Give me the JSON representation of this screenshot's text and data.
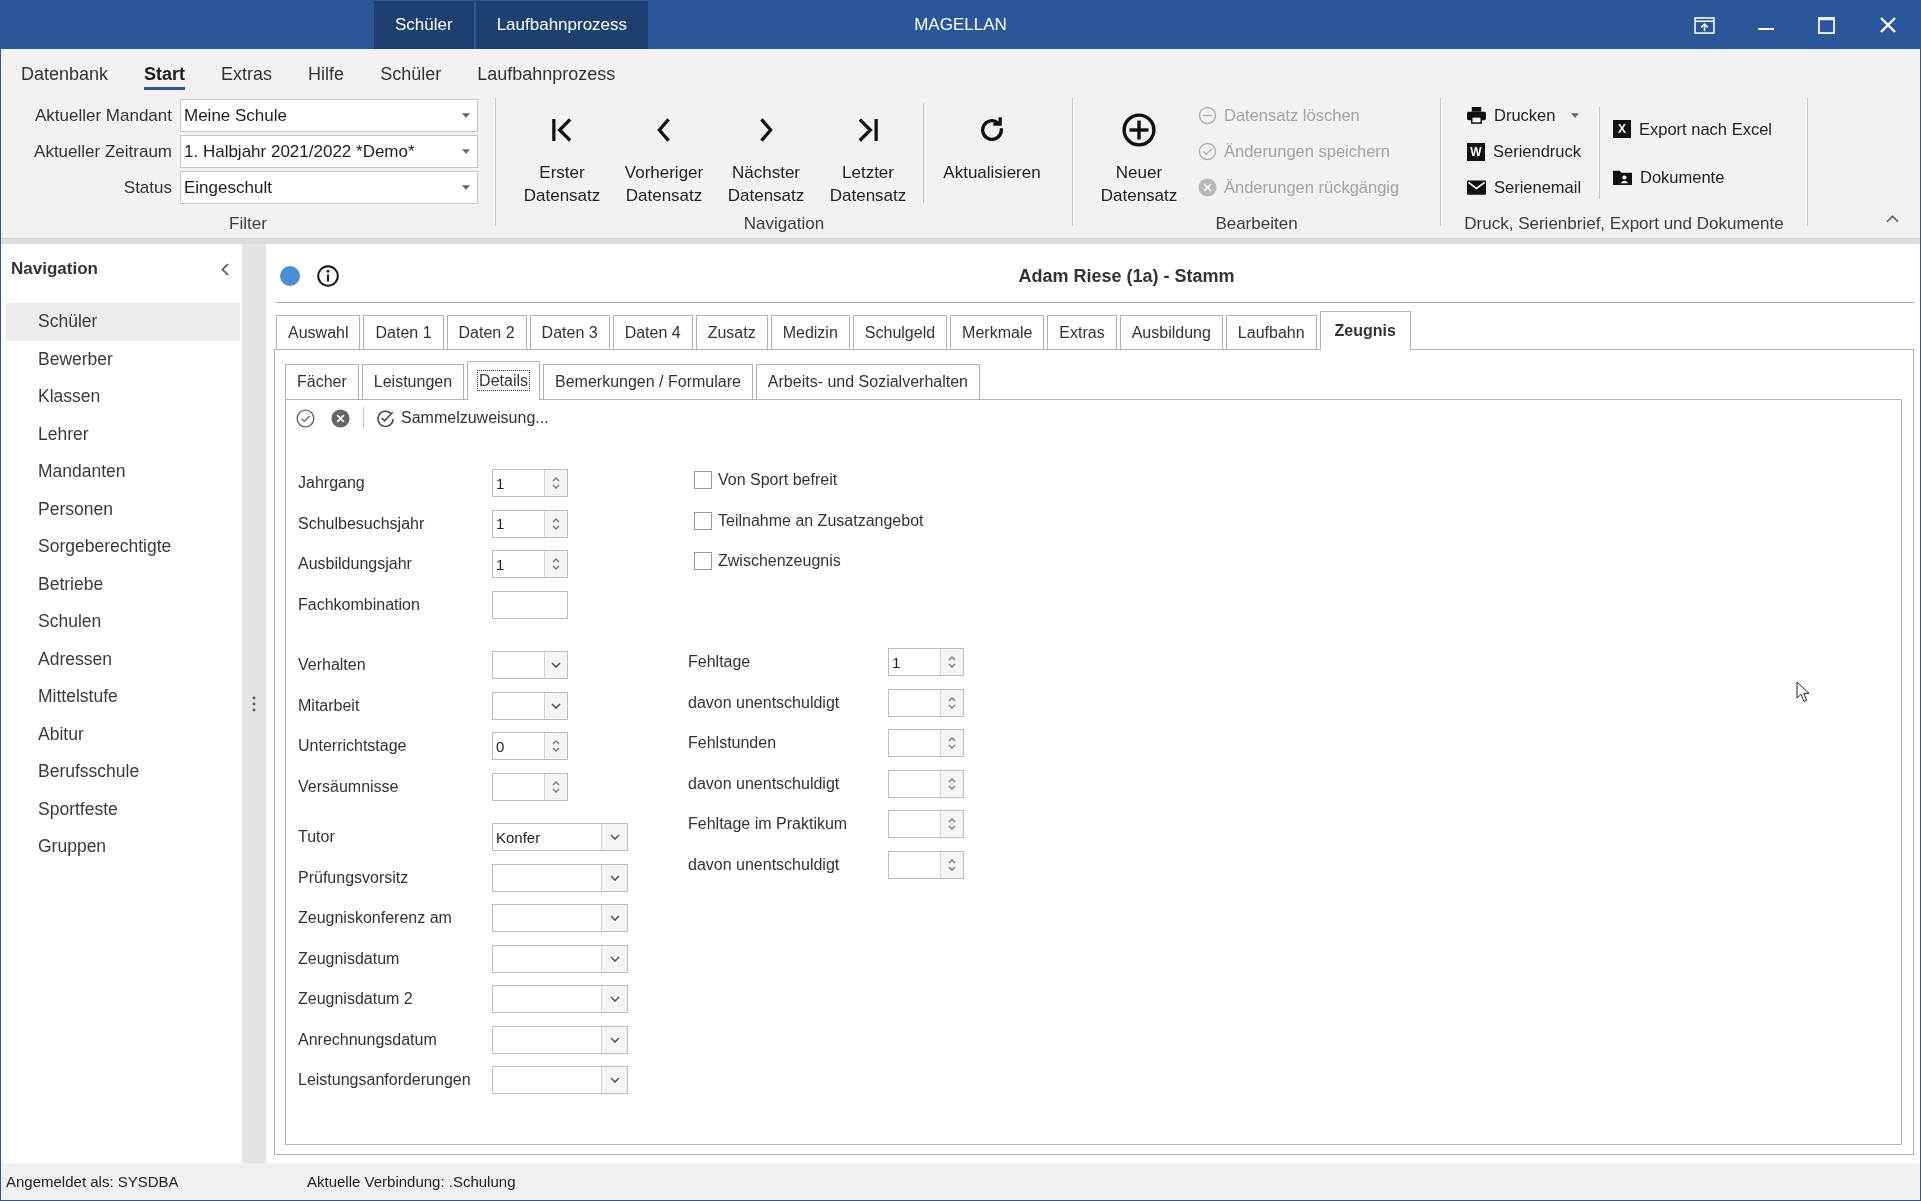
{
  "window": {
    "title": "MAGELLAN",
    "context_tabs": [
      "Schüler",
      "Laufbahnprozess"
    ]
  },
  "ribbon_tabs": [
    {
      "label": "Datenbank",
      "selected": false
    },
    {
      "label": "Start",
      "selected": true
    },
    {
      "label": "Extras",
      "selected": false
    },
    {
      "label": "Hilfe",
      "selected": false
    },
    {
      "label": "Schüler",
      "selected": false
    },
    {
      "label": "Laufbahnprozess",
      "selected": false
    }
  ],
  "ribbon": {
    "filter": {
      "label": "Filter",
      "fields": [
        {
          "label": "Aktueller Mandant",
          "value": "Meine Schule"
        },
        {
          "label": "Aktueller Zeitraum",
          "value": "1. Halbjahr 2021/2022 *Demo*"
        },
        {
          "label": "Status",
          "value": "Eingeschult"
        }
      ]
    },
    "navigation": {
      "label": "Navigation",
      "buttons": [
        {
          "label": "Erster Datensatz"
        },
        {
          "label": "Vorheriger Datensatz"
        },
        {
          "label": "Nächster Datensatz"
        },
        {
          "label": "Letzter Datensatz"
        }
      ],
      "refresh_button": {
        "label": "Aktualisieren"
      }
    },
    "edit": {
      "label": "Bearbeiten",
      "new_button": {
        "label": "Neuer Datensatz"
      },
      "actions": [
        {
          "label": "Datensatz löschen",
          "disabled": true
        },
        {
          "label": "Änderungen speichern",
          "disabled": true
        },
        {
          "label": "Änderungen rückgängig",
          "disabled": true
        }
      ]
    },
    "output": {
      "label": "Druck, Serienbrief, Export und Dokumente",
      "print_actions": [
        {
          "label": "Drucken",
          "dropdown": true
        },
        {
          "label": "Seriendruck",
          "badge": "W",
          "dropdown": false
        },
        {
          "label": "Serienemail",
          "dropdown": false
        }
      ],
      "export_actions": [
        {
          "label": "Export nach Excel",
          "badge": "X"
        },
        {
          "label": "Dokumente"
        }
      ]
    }
  },
  "sidebar": {
    "title": "Navigation",
    "items": [
      {
        "label": "Schüler",
        "selected": true
      },
      {
        "label": "Bewerber",
        "selected": false
      },
      {
        "label": "Klassen",
        "selected": false
      },
      {
        "label": "Lehrer",
        "selected": false
      },
      {
        "label": "Mandanten",
        "selected": false
      },
      {
        "label": "Personen",
        "selected": false
      },
      {
        "label": "Sorgeberechtigte",
        "selected": false
      },
      {
        "label": "Betriebe",
        "selected": false
      },
      {
        "label": "Schulen",
        "selected": false
      },
      {
        "label": "Adressen",
        "selected": false
      },
      {
        "label": "Mittelstufe",
        "selected": false
      },
      {
        "label": "Abitur",
        "selected": false
      },
      {
        "label": "Berufsschule",
        "selected": false
      },
      {
        "label": "Sportfeste",
        "selected": false
      },
      {
        "label": "Gruppen",
        "selected": false
      }
    ]
  },
  "record": {
    "title": "Adam Riese (1a) - Stamm"
  },
  "tabs": [
    {
      "label": "Auswahl",
      "selected": false
    },
    {
      "label": "Daten 1",
      "selected": false
    },
    {
      "label": "Daten 2",
      "selected": false
    },
    {
      "label": "Daten 3",
      "selected": false
    },
    {
      "label": "Daten 4",
      "selected": false
    },
    {
      "label": "Zusatz",
      "selected": false
    },
    {
      "label": "Medizin",
      "selected": false
    },
    {
      "label": "Schulgeld",
      "selected": false
    },
    {
      "label": "Merkmale",
      "selected": false
    },
    {
      "label": "Extras",
      "selected": false
    },
    {
      "label": "Ausbildung",
      "selected": false
    },
    {
      "label": "Laufbahn",
      "selected": false
    },
    {
      "label": "Zeugnis",
      "selected": true
    }
  ],
  "subtabs": [
    {
      "label": "Fächer",
      "selected": false,
      "focused": false
    },
    {
      "label": "Leistungen",
      "selected": false,
      "focused": false
    },
    {
      "label": "Details",
      "selected": true,
      "focused": true
    },
    {
      "label": "Bemerkungen / Formulare",
      "selected": false,
      "focused": false
    },
    {
      "label": "Arbeits- und Sozialverhalten",
      "selected": false,
      "focused": false
    }
  ],
  "toolbar": {
    "assign_button": "Sammelzuweisung..."
  },
  "form": {
    "sections": [
      {
        "fields": [
          {
            "label": "Jahrgang",
            "kind": "spin",
            "value": "1"
          },
          {
            "label": "Schulbesuchsjahr",
            "kind": "spin",
            "value": "1"
          },
          {
            "label": "Ausbildungsjahr",
            "kind": "spin",
            "value": "1"
          },
          {
            "label": "Fachkombination",
            "kind": "text"
          }
        ]
      },
      {
        "fields": [
          {
            "label": "Verhalten",
            "kind": "dropdown"
          },
          {
            "label": "Mitarbeit",
            "kind": "dropdown"
          },
          {
            "label": "Unterrichtstage",
            "kind": "spin",
            "value": "0"
          },
          {
            "label": "Versäumnisse",
            "kind": "spin"
          }
        ]
      },
      {
        "fields": [
          {
            "label": "Tutor",
            "kind": "combobox",
            "value": "Konfer"
          },
          {
            "label": "Prüfungsvorsitz",
            "kind": "combobox"
          },
          {
            "label": "Zeugniskonferenz am",
            "kind": "combobox"
          },
          {
            "label": "Zeugnisdatum",
            "kind": "combobox"
          },
          {
            "label": "Zeugnisdatum 2",
            "kind": "combobox"
          },
          {
            "label": "Anrechnungsdatum",
            "kind": "combobox"
          },
          {
            "label": "Leistungsanforderungen",
            "kind": "combobox"
          }
        ]
      }
    ],
    "checkboxes": [
      {
        "label": "Von Sport befreit",
        "checked": false
      },
      {
        "label": "Teilnahme an Zusatzangebot",
        "checked": false
      },
      {
        "label": "Zwischenzeugnis",
        "checked": false
      }
    ],
    "absence_fields": [
      {
        "label": "Fehltage",
        "kind": "spin",
        "value": "1"
      },
      {
        "label": "davon unentschuldigt",
        "kind": "spin"
      },
      {
        "label": "Fehlstunden",
        "kind": "spin"
      },
      {
        "label": "davon unentschuldigt",
        "kind": "spin"
      },
      {
        "label": "Fehltage im Praktikum",
        "kind": "spin"
      },
      {
        "label": "davon unentschuldigt",
        "kind": "spin"
      }
    ]
  },
  "status_bar": [
    "Angemeldet als: SYSDBA",
    "Aktuelle Verbindung: .Schulung"
  ]
}
